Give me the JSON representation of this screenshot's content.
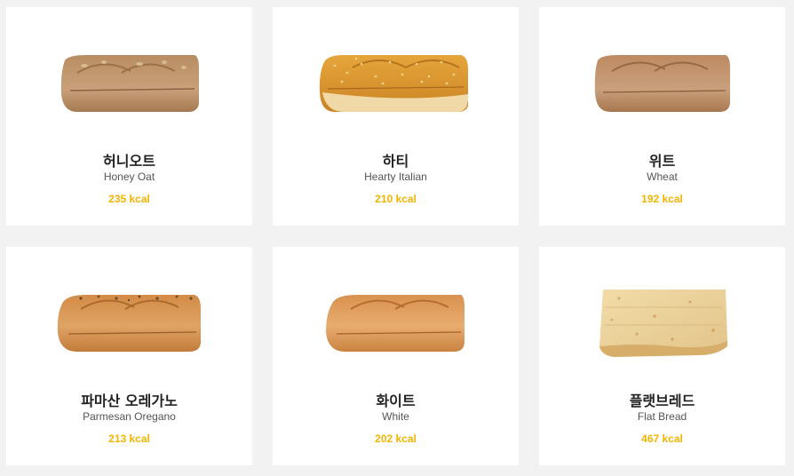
{
  "accent_color": "#f5b400",
  "breads": [
    {
      "name_ko": "허니오트",
      "name_en": "Honey Oat",
      "kcal": "235 kcal",
      "icon": "honey-oat-bread-image"
    },
    {
      "name_ko": "하티",
      "name_en": "Hearty Italian",
      "kcal": "210 kcal",
      "icon": "hearty-italian-bread-image"
    },
    {
      "name_ko": "위트",
      "name_en": "Wheat",
      "kcal": "192 kcal",
      "icon": "wheat-bread-image"
    },
    {
      "name_ko": "파마산 오레가노",
      "name_en": "Parmesan Oregano",
      "kcal": "213 kcal",
      "icon": "parmesan-oregano-bread-image"
    },
    {
      "name_ko": "화이트",
      "name_en": "White",
      "kcal": "202 kcal",
      "icon": "white-bread-image"
    },
    {
      "name_ko": "플랫브레드",
      "name_en": "Flat Bread",
      "kcal": "467 kcal",
      "icon": "flat-bread-image"
    }
  ]
}
